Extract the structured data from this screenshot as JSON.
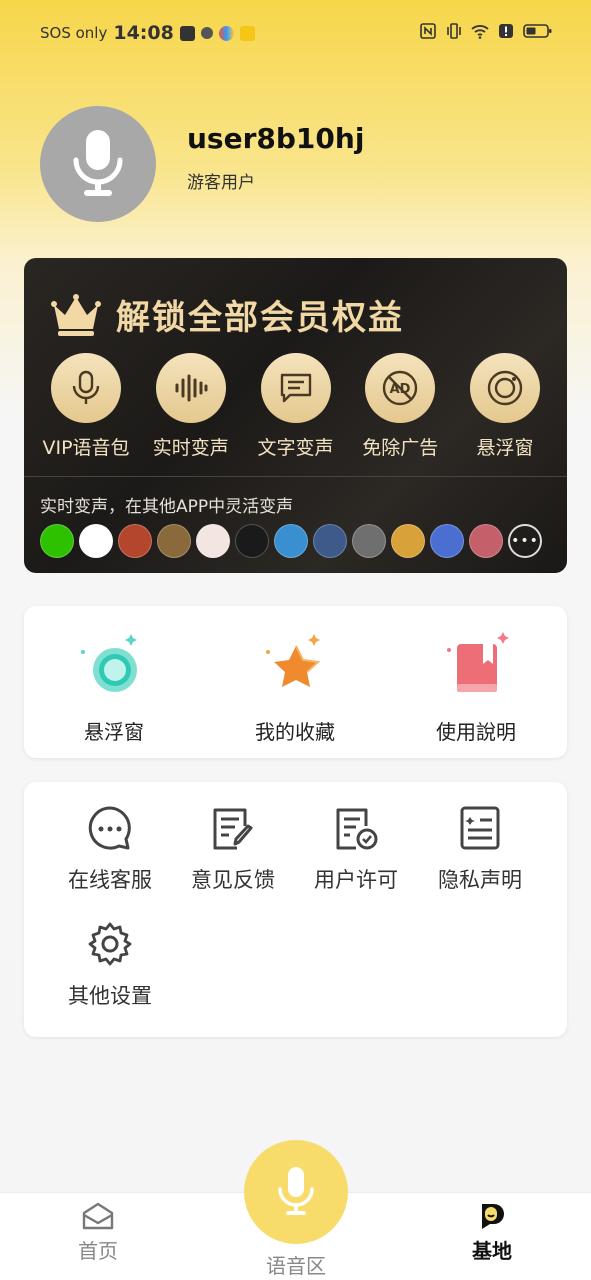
{
  "status_bar": {
    "carrier": "SOS only",
    "time": "14:08"
  },
  "profile": {
    "username": "user8b10hj",
    "user_type": "游客用户"
  },
  "vip": {
    "title": "解锁全部会员权益",
    "items": [
      {
        "label": "VIP语音包",
        "icon": "mic-icon"
      },
      {
        "label": "实时变声",
        "icon": "soundwave-icon"
      },
      {
        "label": "文字变声",
        "icon": "text-bubble-icon"
      },
      {
        "label": "免除广告",
        "icon": "no-ad-icon"
      },
      {
        "label": "悬浮窗",
        "icon": "float-window-icon"
      }
    ],
    "promo": "实时变声，在其他APP中灵活变声",
    "apps": [
      "wechat",
      "qq",
      "game-1",
      "game-2",
      "anime-1",
      "soul",
      "game-3",
      "game-4",
      "game-5",
      "game-6",
      "game-7",
      "anime-2"
    ],
    "app_colors": [
      "#2dc100",
      "#ffffff",
      "#b5462e",
      "#8a6a3a",
      "#f3e6e2",
      "#1a1a1a",
      "#3a8fd0",
      "#3d5a8a",
      "#6f6f6f",
      "#d9a13a",
      "#4a6fd0",
      "#c4606a"
    ]
  },
  "quick": {
    "items": [
      {
        "label": "悬浮窗",
        "icon": "float-ball-icon"
      },
      {
        "label": "我的收藏",
        "icon": "star-icon"
      },
      {
        "label": "使用說明",
        "icon": "manual-book-icon"
      }
    ]
  },
  "misc": {
    "items": [
      {
        "label": "在线客服",
        "icon": "chat-icon"
      },
      {
        "label": "意见反馈",
        "icon": "feedback-icon"
      },
      {
        "label": "用户许可",
        "icon": "license-icon"
      },
      {
        "label": "隐私声明",
        "icon": "privacy-icon"
      },
      {
        "label": "其他设置",
        "icon": "gear-icon"
      }
    ]
  },
  "nav": {
    "home": "首页",
    "voice": "语音区",
    "base": "基地"
  },
  "colors": {
    "accent": "#f7dc6b",
    "vip_gold": "#f1d8a4"
  }
}
